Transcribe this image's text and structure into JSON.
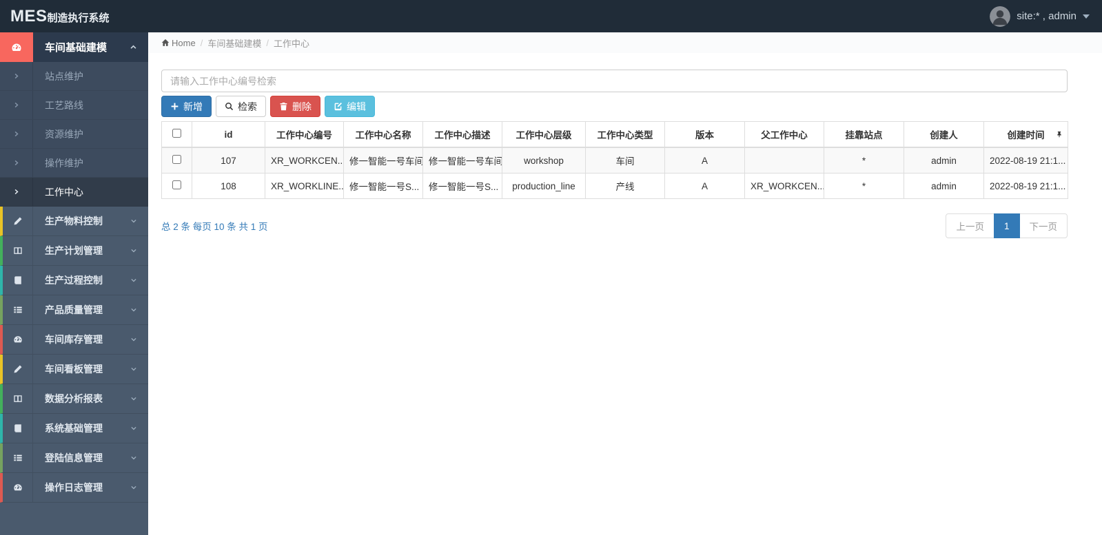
{
  "navbar": {
    "brand_bold": "MES",
    "brand_rest": "制造执行系统",
    "user_label": "site:* , admin"
  },
  "breadcrumb": {
    "home": "Home",
    "level1": "车间基础建模",
    "level2": "工作中心"
  },
  "sidebar": {
    "group": {
      "label": "车间基础建模",
      "icon": "gauge-icon",
      "accent": "#f8675e"
    },
    "submenu": [
      {
        "label": "站点维护",
        "active": false
      },
      {
        "label": "工艺路线",
        "active": false
      },
      {
        "label": "资源维护",
        "active": false
      },
      {
        "label": "操作维护",
        "active": false
      },
      {
        "label": "工作中心",
        "active": true
      }
    ],
    "items": [
      {
        "label": "生产物料控制",
        "icon": "pencil-icon",
        "accent": "#e9c326"
      },
      {
        "label": "生产计划管理",
        "icon": "columns-icon",
        "accent": "#43b05c"
      },
      {
        "label": "生产过程控制",
        "icon": "book-icon",
        "accent": "#2fb5aa"
      },
      {
        "label": "产品质量管理",
        "icon": "list-icon",
        "accent": "#76a25f"
      },
      {
        "label": "车间库存管理",
        "icon": "gauge-icon",
        "accent": "#dd5a52"
      },
      {
        "label": "车间看板管理",
        "icon": "pencil-icon",
        "accent": "#e9c326"
      },
      {
        "label": "数据分析报表",
        "icon": "columns-icon",
        "accent": "#43b05c"
      },
      {
        "label": "系统基础管理",
        "icon": "book-icon",
        "accent": "#2fb5aa"
      },
      {
        "label": "登陆信息管理",
        "icon": "list-icon",
        "accent": "#76a25f"
      },
      {
        "label": "操作日志管理",
        "icon": "gauge-icon",
        "accent": "#dd5a52"
      }
    ]
  },
  "toolbar": {
    "search_placeholder": "请输入工作中心编号检索",
    "add_label": "新增",
    "search_label": "检索",
    "delete_label": "删除",
    "edit_label": "编辑",
    "add_icon": "plus-icon",
    "search_icon": "search-icon",
    "delete_icon": "trash-icon",
    "edit_icon": "edit-icon"
  },
  "table": {
    "columns": [
      "id",
      "工作中心编号",
      "工作中心名称",
      "工作中心描述",
      "工作中心层级",
      "工作中心类型",
      "版本",
      "父工作中心",
      "挂靠站点",
      "创建人",
      "创建时间"
    ],
    "rows": [
      {
        "cells": [
          "107",
          "XR_WORKCEN...",
          "修一智能一号车间",
          "修一智能一号车间",
          "workshop",
          "车间",
          "A",
          "",
          "*",
          "admin",
          "2022-08-19 21:1..."
        ]
      },
      {
        "cells": [
          "108",
          "XR_WORKLINE...",
          "修一智能一号S...",
          "修一智能一号S...",
          "production_line",
          "产线",
          "A",
          "XR_WORKCEN...",
          "*",
          "admin",
          "2022-08-19 21:1..."
        ]
      }
    ]
  },
  "pagination": {
    "summary": "总 2 条 每页 10 条 共 1 页",
    "prev_label": "上一页",
    "page_label": "1",
    "next_label": "下一页"
  },
  "colors": {
    "navbar_bg": "#202c38",
    "sidebar_bg": "#4a5a6d",
    "sidebar_submenu_bg": "#3d4b5e",
    "sidebar_group_bg": "#2c3a4d",
    "active_item_bg": "#313c4a",
    "active_group_icon_bg": "#f8675e",
    "primary": "#337ab7",
    "danger": "#d9534f",
    "info": "#5bc0de",
    "table_stripe": "#f9f9f9"
  }
}
